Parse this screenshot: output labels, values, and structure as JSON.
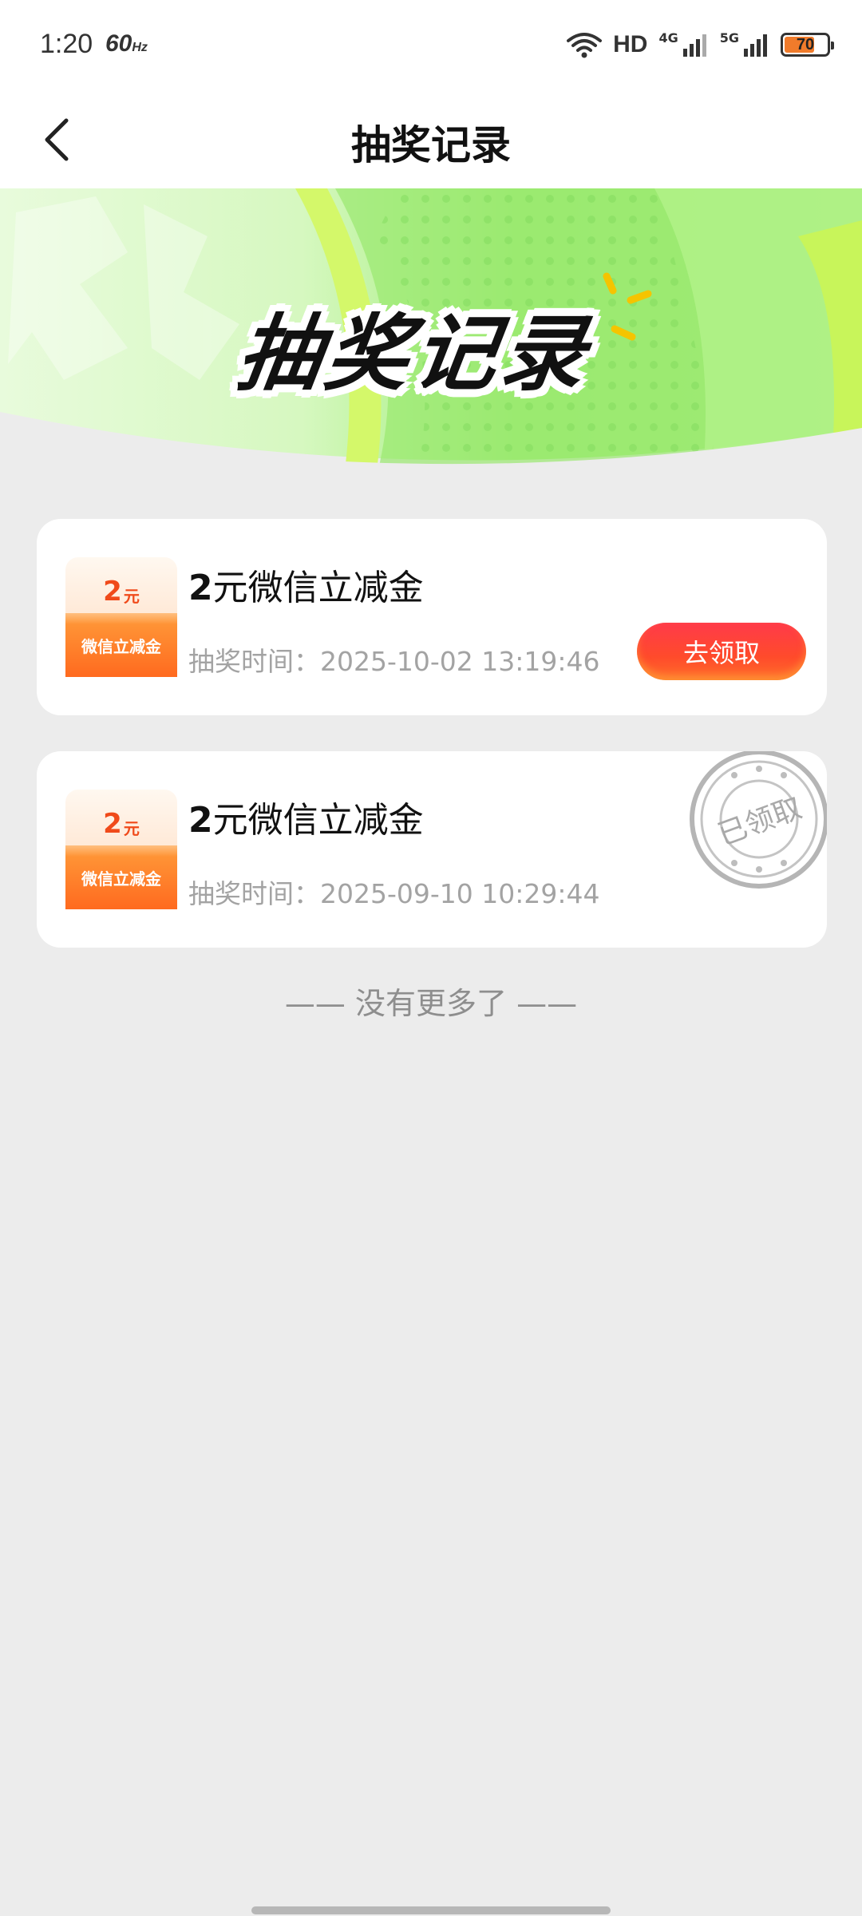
{
  "status_bar": {
    "time": "1:20",
    "refresh_rate": "60",
    "refresh_unit": "Hz",
    "hd_label": "HD",
    "network_4g": "4G",
    "network_5g": "5G",
    "battery_level": "70",
    "battery_fill_percent": 70,
    "battery_color": "#f07b2b"
  },
  "nav": {
    "title": "抽奖记录",
    "back_icon": "chevron-left-icon"
  },
  "banner": {
    "title": "抽奖记录",
    "colors": {
      "light_green": "#dcf8c8",
      "green": "#8fe86a",
      "lime": "#c4f24a"
    }
  },
  "records": [
    {
      "amount": "2",
      "amount_unit": "元",
      "coupon_label": "微信立减金",
      "name_amount": "2",
      "name_text": "元微信立减金",
      "time_label": "抽奖时间：",
      "time_value": "2025-10-02 13:19:46",
      "action_label": "去领取",
      "status": "unclaimed"
    },
    {
      "amount": "2",
      "amount_unit": "元",
      "coupon_label": "微信立减金",
      "name_amount": "2",
      "name_text": "元微信立减金",
      "time_label": "抽奖时间：",
      "time_value": "2025-09-10 10:29:44",
      "stamp_label": "已领取",
      "status": "claimed"
    }
  ],
  "footer": {
    "no_more": "—— 没有更多了 ——"
  },
  "theme": {
    "accent_red": "#ff3a4a",
    "coupon_orange": "#ff6a1f",
    "page_bg": "#ececec"
  }
}
